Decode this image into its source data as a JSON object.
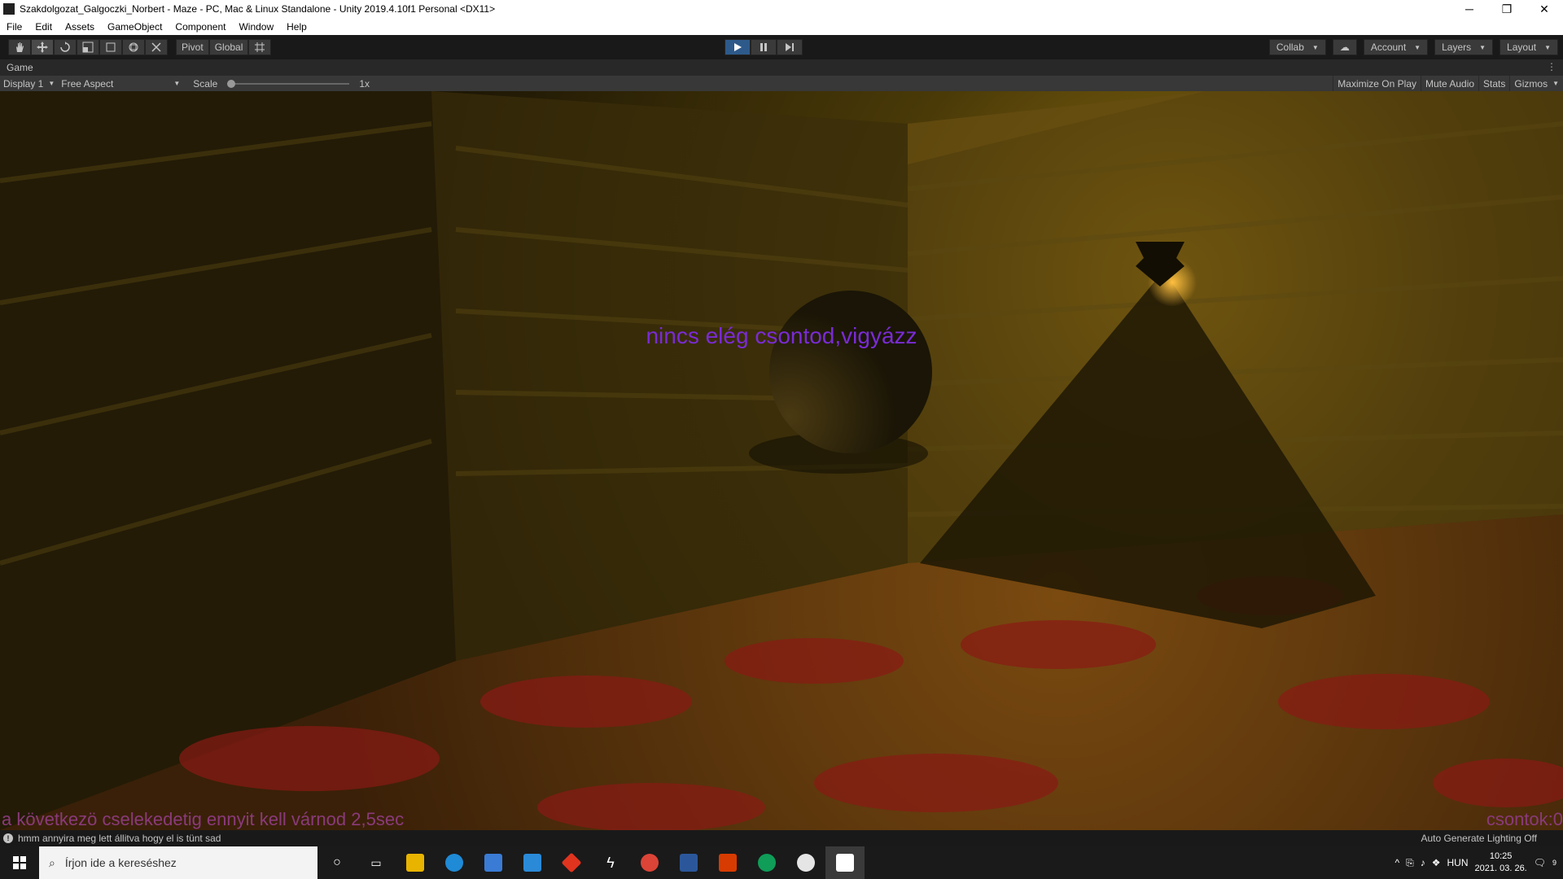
{
  "window": {
    "title": "Szakdolgozat_Galgoczki_Norbert - Maze - PC, Mac & Linux Standalone - Unity 2019.4.10f1 Personal <DX11>",
    "minimize": "─",
    "restore": "❐",
    "close": "✕"
  },
  "menu": [
    "File",
    "Edit",
    "Assets",
    "GameObject",
    "Component",
    "Window",
    "Help"
  ],
  "toolbar": {
    "pivot_label": "Pivot",
    "global_label": "Global",
    "collab_label": "Collab",
    "account_label": "Account",
    "layers_label": "Layers",
    "layout_label": "Layout"
  },
  "tab": {
    "label": "Game",
    "menu": "⋮"
  },
  "gamebar": {
    "display": "Display 1",
    "aspect": "Free Aspect",
    "scale_label": "Scale",
    "scale_value": "1x",
    "scale_fraction": 0.0,
    "maximize": "Maximize On Play",
    "mute": "Mute Audio",
    "stats": "Stats",
    "gizmos": "Gizmos"
  },
  "game": {
    "warning": "nincs elég csontod,vigyázz",
    "wait": "a következö cselekedetig ennyit kell várnod 2,5sec",
    "bones": "csontok:0"
  },
  "status": {
    "message": "hmm annyira meg lett állitva hogy el is tünt sad",
    "lighting": "Auto Generate Lighting Off"
  },
  "taskbar": {
    "search_placeholder": "Írjon ide a kereséshez",
    "lang": "HUN",
    "time": "10:25",
    "date": "2021. 03. 26.",
    "notifications": "9"
  },
  "colors": {
    "warning_text": "#7a2bd6",
    "hud_text": "#8a3a7a",
    "play_active": "#2d5a8a"
  }
}
